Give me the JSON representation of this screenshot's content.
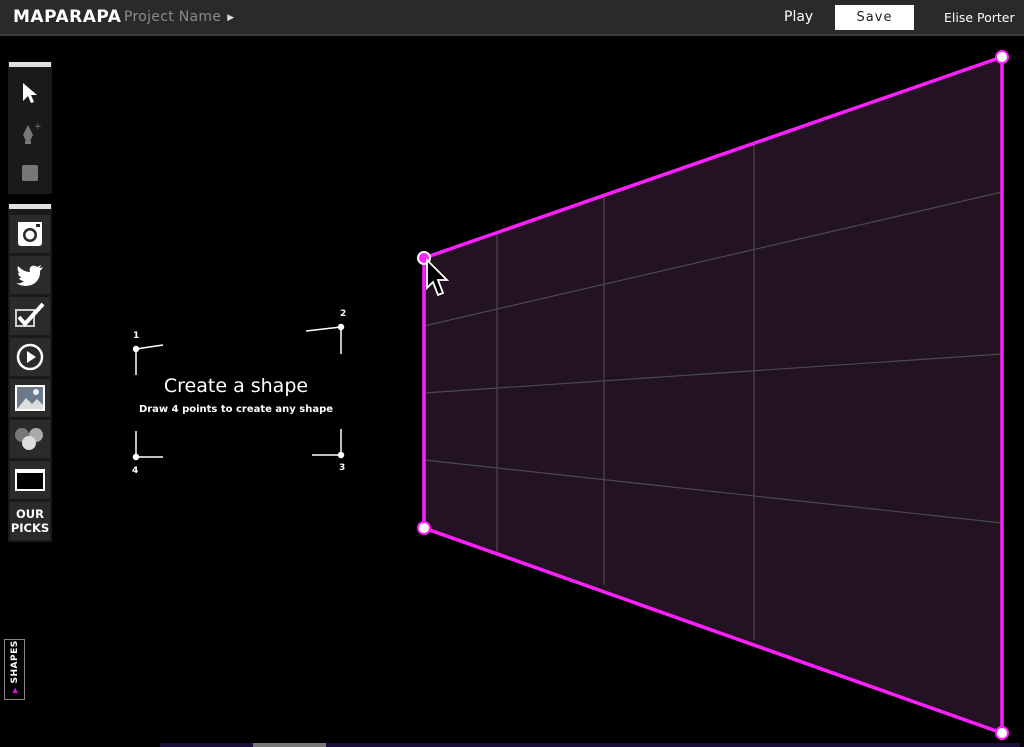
{
  "header": {
    "logo": "MAPARAPA",
    "project_name": "Project Name",
    "play_label": "Play",
    "save_label": "Save",
    "user_name": "Elise Porter"
  },
  "tools": {
    "drawing": [
      {
        "name": "select-tool",
        "icon": "arrow-pointer-icon"
      },
      {
        "name": "pen-tool",
        "icon": "pen-add-icon"
      },
      {
        "name": "rectangle-tool",
        "icon": "square-icon"
      }
    ],
    "sources": [
      {
        "name": "instagram-source",
        "icon": "instagram-icon"
      },
      {
        "name": "twitter-source",
        "icon": "twitter-bird-icon"
      },
      {
        "name": "foursquare-source",
        "icon": "checkmark-icon"
      },
      {
        "name": "video-source",
        "icon": "play-circle-icon"
      },
      {
        "name": "image-source",
        "icon": "image-icon"
      },
      {
        "name": "color-source",
        "icon": "circles-icon"
      },
      {
        "name": "web-source",
        "icon": "browser-window-icon"
      }
    ],
    "our_picks_line1": "OUR",
    "our_picks_line2": "PICKS"
  },
  "shapes_tab_label": "SHAPES",
  "hint": {
    "title": "Create a shape",
    "subtitle": "Draw 4 points to create any shape",
    "corner_numbers": [
      "1",
      "2",
      "3",
      "4"
    ]
  },
  "colors": {
    "accent": "#ff1fff",
    "shape_fill": "#221222",
    "grid": "#4a4a4a",
    "topbar": "#2a2a2a"
  }
}
